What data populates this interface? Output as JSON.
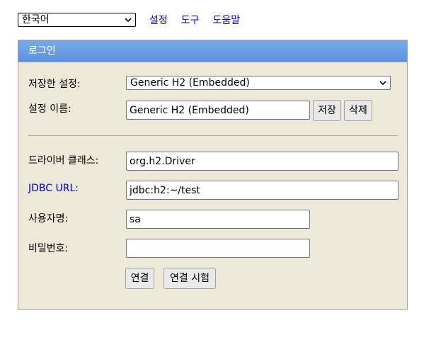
{
  "topbar": {
    "language_selected": "한국어",
    "nav": [
      "설정",
      "도구",
      "도움말"
    ]
  },
  "login": {
    "header": "로그인",
    "saved_settings_label": "저장한 설정:",
    "saved_settings_value": "Generic H2 (Embedded)",
    "setting_name_label": "설정 이름:",
    "setting_name_value": "Generic H2 (Embedded)",
    "save_button": "저장",
    "delete_button": "삭제",
    "driver_class_label": "드라이버 클래스:",
    "driver_class_value": "org.h2.Driver",
    "jdbc_url_label": "JDBC URL:",
    "jdbc_url_value": "jdbc:h2:~/test",
    "username_label": "사용자명:",
    "username_value": "sa",
    "password_label": "비밀번호:",
    "password_value": "",
    "connect_button": "연결",
    "test_connection_button": "연결 시험"
  },
  "colors": {
    "header_blue": "#5a93e0",
    "panel_bg": "#ece9d8",
    "link_blue": "#0000cc"
  }
}
